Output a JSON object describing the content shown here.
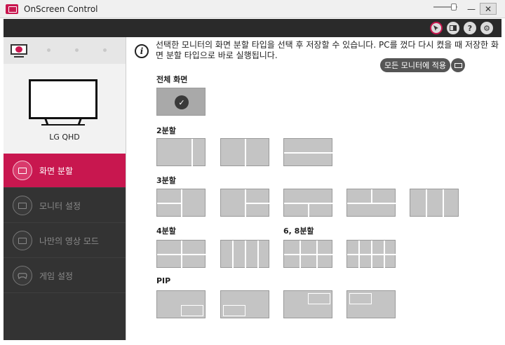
{
  "window": {
    "title": "OnScreen Control",
    "minimize": "—",
    "maximize": "☐",
    "close": "✕"
  },
  "toolbar": {
    "help": "?",
    "settings": "⚙"
  },
  "monitor": {
    "name": "LG QHD"
  },
  "menu": {
    "items": [
      {
        "label": "화면 분할"
      },
      {
        "label": "모니터 설정"
      },
      {
        "label": "나만의 영상 모드"
      },
      {
        "label": "게임 설정"
      }
    ]
  },
  "main": {
    "info_text": "선택한 모니터의 화면 분할 타입을 선택 후 저장할 수 있습니다. PC를 껐다 다시 켰을 때 저장한 화면 분할 타입으로 바로 실행됩니다.",
    "apply_all_label": "모든 모니터에 적용",
    "check_glyph": "✓",
    "sections": {
      "full": "전체 화면",
      "split2": "2분할",
      "split3": "3분할",
      "split4": "4분할",
      "split68": "6, 8분할",
      "pip": "PIP"
    }
  },
  "colors": {
    "accent": "#c8174f",
    "sidebar_bg": "#333333",
    "tile": "#c4c4c4"
  },
  "icons": [
    "app-icon",
    "pointer-icon",
    "monitor-switch-icon",
    "help-icon",
    "gear-icon",
    "info-icon",
    "split-screen-icon",
    "monitor-settings-icon",
    "picture-mode-icon",
    "gamepad-icon",
    "check-icon"
  ]
}
